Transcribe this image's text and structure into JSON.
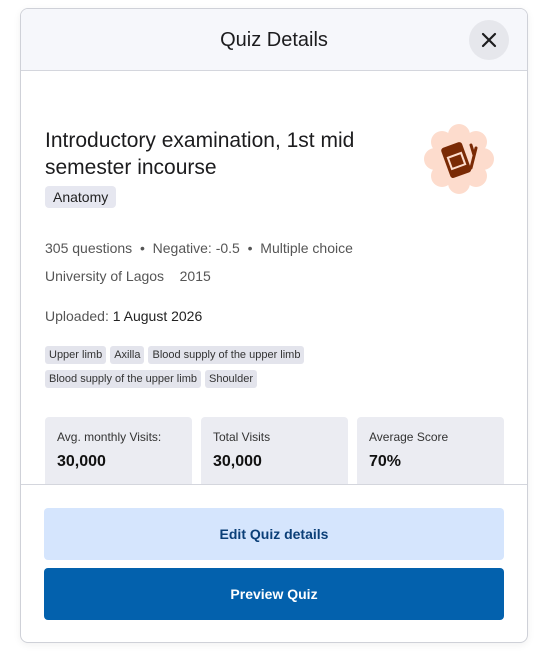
{
  "header": {
    "title": "Quiz Details"
  },
  "quiz": {
    "title": "Introductory examination, 1st mid semester incourse",
    "subject": "Anatomy",
    "questions": "305 questions",
    "negative": "Negative: -0.5",
    "type": "Multiple choice",
    "institution": "University of Lagos",
    "year": "2015",
    "uploaded_label": "Uploaded:",
    "uploaded_date": "1 August 2026",
    "tags": [
      "Upper limb",
      "Axilla",
      "Blood supply of the upper limb",
      "Blood supply of the upper limb",
      "Shoulder"
    ]
  },
  "stats": [
    {
      "label": "Avg. monthly Visits:",
      "value": "30,000"
    },
    {
      "label": "Total Visits",
      "value": "30,000"
    },
    {
      "label": "Average Score",
      "value": "70%"
    }
  ],
  "buttons": {
    "edit": "Edit Quiz details",
    "preview": "Preview Quiz"
  },
  "colors": {
    "primary": "#0361ad",
    "secondary": "#d5e5fd",
    "icon_bg": "#fddccd",
    "icon": "#7a2a05"
  }
}
